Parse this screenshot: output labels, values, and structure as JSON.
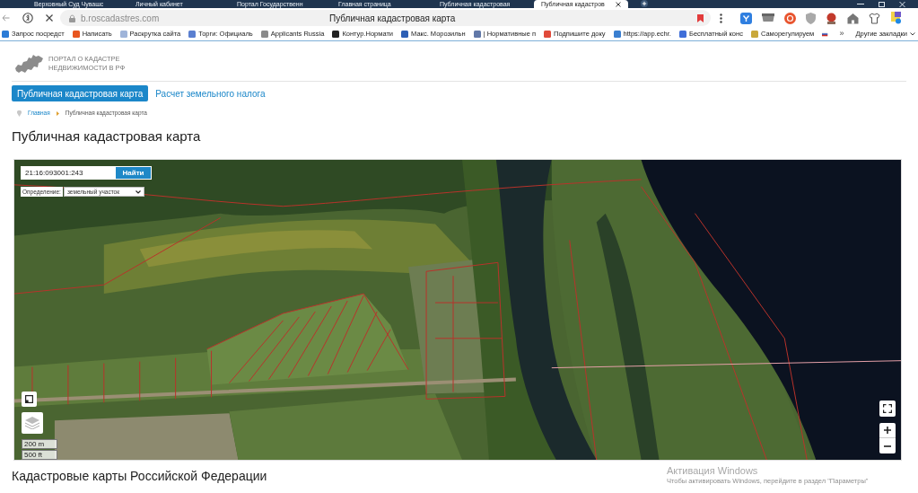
{
  "browser": {
    "tabs": [
      {
        "title": "Верховный Суд Чувашс",
        "selected": false
      },
      {
        "title": "Личный кабинет",
        "selected": false
      },
      {
        "title": "Портал Государственн",
        "selected": false
      },
      {
        "title": "Главная страница",
        "selected": false
      },
      {
        "title": "Публичная кадастровая",
        "selected": false
      },
      {
        "title": "Публичная кадастров",
        "selected": true
      }
    ],
    "address": "b.roscadastres.com",
    "page_title": "Публичная кадастровая карта",
    "bookmarks": [
      {
        "label": "Запрос посредст",
        "color": "#2b7bd6"
      },
      {
        "label": "Написать",
        "color": "#e8561f"
      },
      {
        "label": "Раскрутка сайта",
        "color": "#9fb4d9"
      },
      {
        "label": "Торги: Официаль",
        "color": "#5a7fd0"
      },
      {
        "label": "Applicants Russia",
        "color": "#8a8a8a"
      },
      {
        "label": "Контур.Нормати",
        "color": "#222222"
      },
      {
        "label": "Макс. Морозильн",
        "color": "#2d5fb5"
      },
      {
        "label": "| Нормативные п",
        "color": "#6178a8"
      },
      {
        "label": "Подпишите доку",
        "color": "#e04a3a"
      },
      {
        "label": "https://app.echr.",
        "color": "#3a7fd0"
      },
      {
        "label": "Бесплатный конс",
        "color": "#3f6ed8"
      },
      {
        "label": "Саморегулируем",
        "color": "#c9a83a"
      }
    ],
    "more": "»",
    "other_bookmarks": "Другие закладки"
  },
  "site": {
    "logo_lines": [
      "ПОРТАЛ О КАДАСТРЕ",
      "НЕДВИЖИМОСТИ В РФ"
    ],
    "nav": [
      {
        "label": "Публичная кадастровая карта",
        "selected": true
      },
      {
        "label": "Расчет земельного налога",
        "selected": false
      }
    ],
    "breadcrumbs": [
      "Главная",
      "Публичная кадастровая карта"
    ],
    "heading": "Публичная кадастровая карта"
  },
  "map": {
    "search": {
      "value": "21:16:093001:243",
      "button": "Найти"
    },
    "mode": {
      "label": "Определение:",
      "value": "земельный участок"
    },
    "scale": [
      "200 m",
      "500 ft"
    ]
  },
  "section_heading": "Кадастровые карты Российской Федерации",
  "os_notice": {
    "title": "Активация Windows",
    "text": "Чтобы активировать Windows, перейдите в раздел \"Параметры\""
  }
}
